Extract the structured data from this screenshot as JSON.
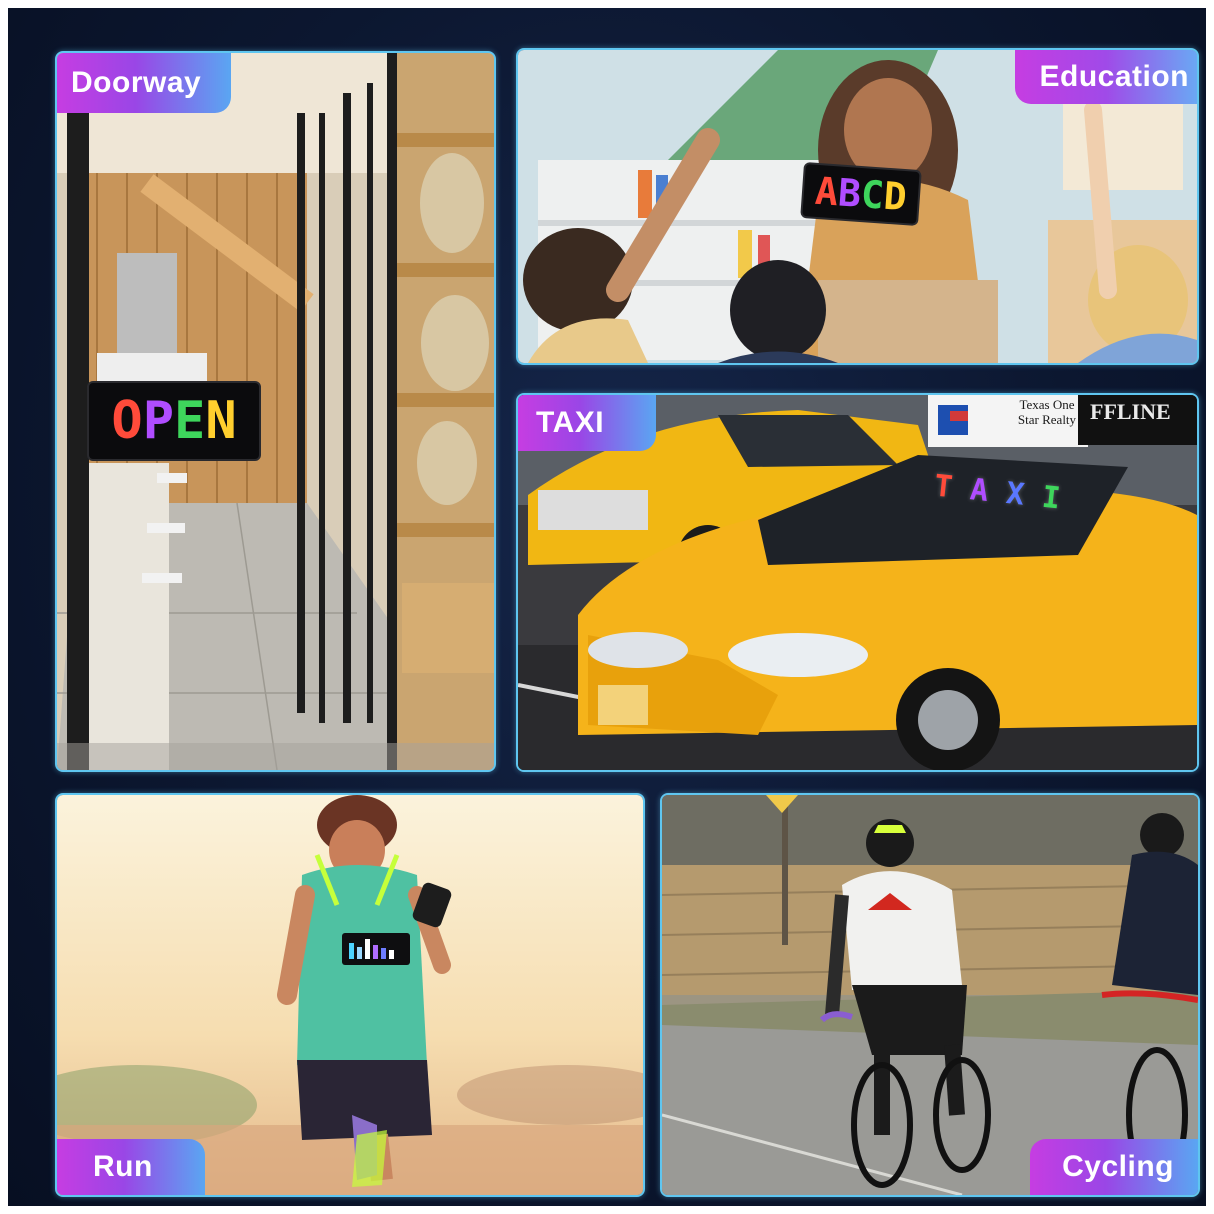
{
  "labels": {
    "doorway": "Doorway",
    "education": "Education",
    "taxi": "TAXI",
    "run": "Run",
    "cycling": "Cycling"
  },
  "led_signs": {
    "open": [
      "O",
      "P",
      "E",
      "N"
    ],
    "abcd": [
      "A",
      "B",
      "C",
      "D"
    ],
    "taxi": [
      "T",
      "A",
      "X",
      "I"
    ]
  },
  "taxi_sign": {
    "line1": "Texas One",
    "line2": "Star Realty"
  },
  "truck_text": "FFLINE",
  "colors": {
    "tag_gradient_start": "#c63de2",
    "tag_gradient_end": "#5aa6f2",
    "panel_border": "#5fc6f0",
    "background": "#0c1730",
    "led_colors": [
      "#ff4b3a",
      "#b04dff",
      "#5a78ff",
      "#3ed65c",
      "#ffcf2e"
    ]
  }
}
